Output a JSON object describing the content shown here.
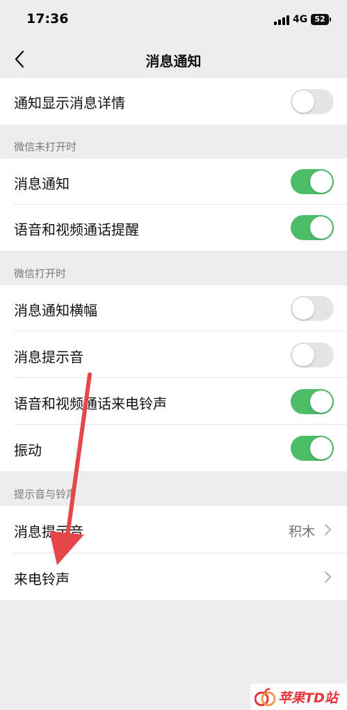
{
  "status_bar": {
    "time": "17:36",
    "network": "4G",
    "battery": "52",
    "icons": [
      "cellular-signal-icon",
      "battery-icon"
    ]
  },
  "nav": {
    "back_icon": "chevron-left-icon",
    "title": "消息通知"
  },
  "top_row": {
    "label": "通知显示消息详情",
    "toggle_on": false
  },
  "section_closed": {
    "header": "微信未打开时",
    "rows": [
      {
        "label": "消息通知",
        "toggle_on": true
      },
      {
        "label": "语音和视频通话提醒",
        "toggle_on": true
      }
    ]
  },
  "section_open": {
    "header": "微信打开时",
    "rows": [
      {
        "label": "消息通知横幅",
        "toggle_on": false
      },
      {
        "label": "消息提示音",
        "toggle_on": false
      },
      {
        "label": "语音和视频通话来电铃声",
        "toggle_on": true
      },
      {
        "label": "振动",
        "toggle_on": true
      }
    ]
  },
  "section_sound": {
    "header": "提示音与铃声",
    "rows": [
      {
        "label": "消息提示音",
        "value": "积木",
        "icon": "chevron-right-icon"
      },
      {
        "label": "来电铃声",
        "value": "",
        "icon": "chevron-right-icon"
      }
    ]
  },
  "annotation": {
    "type": "red-arrow",
    "color": "#e5474b"
  },
  "watermark": {
    "text": "苹果TD站",
    "color": "#e8333a"
  },
  "colors": {
    "toggle_on": "#4cbe68",
    "toggle_off": "#e5e5e5",
    "background": "#ededed"
  }
}
